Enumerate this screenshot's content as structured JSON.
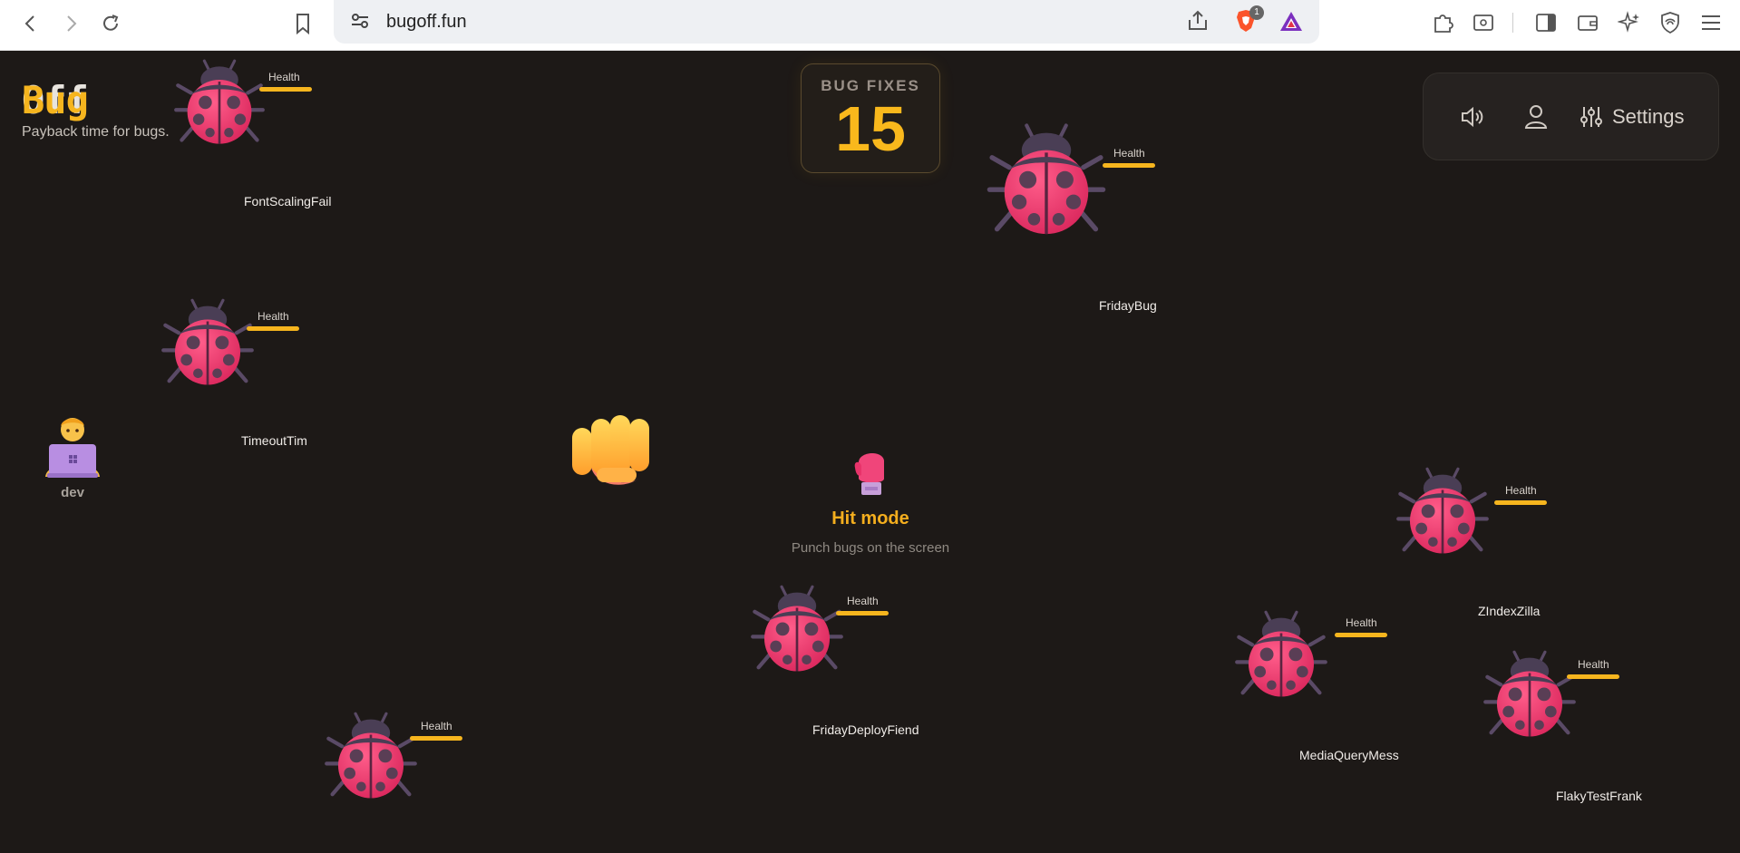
{
  "browser": {
    "url": "bugoff.fun",
    "shield_badge": "1"
  },
  "brand": {
    "logo_part1": "Bug",
    "logo_part2": "Off",
    "tagline": "Payback time for bugs."
  },
  "score": {
    "label": "BUG FIXES",
    "value": "15"
  },
  "settings": {
    "label": "Settings"
  },
  "health_label": "Health",
  "bugs": [
    {
      "name": "FontScalingFail",
      "health": 1.0
    },
    {
      "name": "FridayBug",
      "health": 1.0
    },
    {
      "name": "TimeoutTim",
      "health": 1.0
    },
    {
      "name": "ZIndexZilla",
      "health": 1.0
    },
    {
      "name": "FridayDeployFiend",
      "health": 1.0
    },
    {
      "name": "MediaQueryMess",
      "health": 1.0
    },
    {
      "name": "FlakyTestFrank",
      "health": 1.0
    },
    {
      "name": "",
      "health": 1.0
    }
  ],
  "dev": {
    "label": "dev"
  },
  "mode": {
    "title": "Hit mode",
    "description": "Punch bugs on the screen"
  },
  "colors": {
    "accent": "#f6b51e",
    "background": "#1d1917",
    "bug_body": "#e03a6a"
  }
}
